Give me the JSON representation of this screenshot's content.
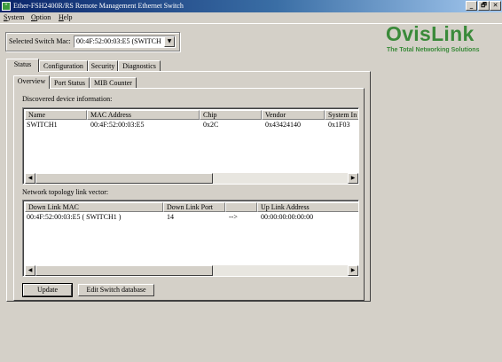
{
  "window": {
    "title": "Ether-FSH2400R/RS Remote Management Ethernet Switch",
    "icon": "app-icon",
    "controls": [
      "_",
      "🗗",
      "✕"
    ]
  },
  "menubar": {
    "items": [
      {
        "label": "System"
      },
      {
        "label": "Option"
      },
      {
        "label": "Help"
      }
    ]
  },
  "switch_selector": {
    "label": "Selected Switch Mac:",
    "value": "00:4F:52:00:03:E5 (SWITCH",
    "arrow": "▼"
  },
  "logo": {
    "name": "OvisLink",
    "tagline": "The Total Networking Solutions",
    "color": "#3a8a3a"
  },
  "main_tabs": [
    {
      "label": "Status",
      "active": true
    },
    {
      "label": "Configuration",
      "active": false
    },
    {
      "label": "Security",
      "active": false
    },
    {
      "label": "Diagnostics",
      "active": false
    }
  ],
  "sub_tabs": [
    {
      "label": "Overview",
      "active": true
    },
    {
      "label": "Port Status",
      "active": false
    },
    {
      "label": "MIB Counter",
      "active": false
    }
  ],
  "devices": {
    "caption": "Discovered device information:",
    "columns": [
      "Name",
      "MAC Address",
      "Chip",
      "Vendor",
      "System In"
    ],
    "rows": [
      [
        "SWITCH1",
        "00:4F:52:00:03:E5",
        "0x2C",
        "0x43424140",
        "0x1F03"
      ]
    ]
  },
  "topology": {
    "caption": "Network topology link vector:",
    "columns": [
      "Down Link MAC",
      "Down Link Port",
      "",
      "Up Link Address"
    ],
    "rows": [
      [
        "00:4F:52:00:03:E5 ( SWITCH1 )",
        "14",
        "-->",
        "00:00:00:00:00:00"
      ]
    ]
  },
  "scroll": {
    "left": "◀",
    "right": "▶"
  },
  "buttons": {
    "update": "Update",
    "edit_db": "Edit Switch database"
  }
}
